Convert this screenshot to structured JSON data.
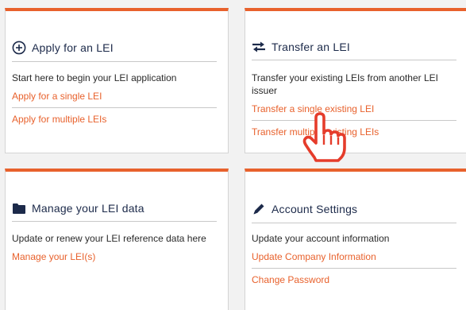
{
  "cards": {
    "apply": {
      "icon": "plus-circle-icon",
      "title": "Apply for an LEI",
      "description": "Start here to begin your LEI application",
      "links": [
        "Apply for a single LEI",
        "Apply for multiple LEIs"
      ]
    },
    "transfer": {
      "icon": "transfer-arrows-icon",
      "title": "Transfer an LEI",
      "description": "Transfer your existing LEIs from another LEI issuer",
      "links": [
        "Transfer a single existing LEI",
        "Transfer multiple existing LEIs"
      ]
    },
    "manage": {
      "icon": "folder-icon",
      "title": "Manage your LEI data",
      "description": "Update or renew your LEI reference data here",
      "links": [
        "Manage your LEI(s)"
      ]
    },
    "account": {
      "icon": "pencil-icon",
      "title": "Account Settings",
      "description": "Update your account information",
      "links": [
        "Update Company Information",
        "Change Password"
      ]
    }
  },
  "cursor": {
    "icon": "hand-pointer-icon"
  },
  "colors": {
    "accent": "#e8612c",
    "title": "#1c2a4a",
    "icon": "#1c2a4a"
  }
}
